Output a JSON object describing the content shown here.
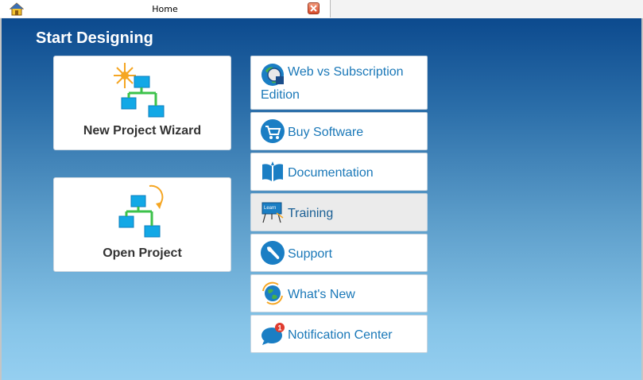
{
  "tab": {
    "title": "Home"
  },
  "main": {
    "heading": "Start Designing",
    "cards": {
      "new_project": "New Project Wizard",
      "open_project": "Open Project"
    },
    "links": [
      {
        "label": "Web vs Subscription Edition",
        "icon": "globe-edition-icon"
      },
      {
        "label": "Buy Software",
        "icon": "shopping-cart-icon"
      },
      {
        "label": "Documentation",
        "icon": "book-icon"
      },
      {
        "label": "Training",
        "icon": "learn-board-icon"
      },
      {
        "label": "Support",
        "icon": "wrench-icon"
      },
      {
        "label": "What's New",
        "icon": "globe-refresh-icon"
      },
      {
        "label": "Notification Center",
        "icon": "chat-bubble-icon",
        "badge": "1"
      }
    ]
  },
  "colors": {
    "accent": "#1a78b8",
    "background_top": "#0c4a8e",
    "background_bottom": "#95cff0"
  }
}
